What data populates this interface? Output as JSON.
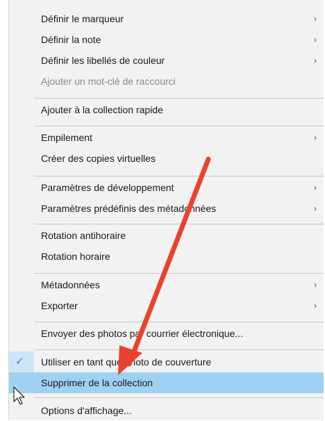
{
  "menu": {
    "items": [
      {
        "label": "Définir le marqueur",
        "submenu_icon": "chevron-right-icon"
      },
      {
        "label": "Définir la note",
        "submenu_icon": "chevron-right-icon"
      },
      {
        "label": "Définir les libellés de couleur",
        "submenu_icon": "chevron-right-icon"
      },
      {
        "label": "Ajouter un mot-clé de raccourci",
        "disabled": true
      },
      {
        "label": "Ajouter à la collection rapide"
      },
      {
        "label": "Empilement",
        "submenu_icon": "chevron-right-icon"
      },
      {
        "label": "Créer des copies virtuelles"
      },
      {
        "label": "Paramètres de développement",
        "submenu_icon": "chevron-right-icon"
      },
      {
        "label": "Paramètres prédéfinis des métadonnées",
        "submenu_icon": "chevron-right-icon"
      },
      {
        "label": "Rotation antihoraire"
      },
      {
        "label": "Rotation horaire"
      },
      {
        "label": "Métadonnées",
        "submenu_icon": "chevron-right-icon"
      },
      {
        "label": "Exporter",
        "submenu_icon": "chevron-right-icon"
      },
      {
        "label": "Envoyer des photos par courrier électronique..."
      },
      {
        "label": "Utiliser en tant que photo de couverture",
        "checked": true
      },
      {
        "label": "Supprimer de la collection",
        "highlighted": true
      },
      {
        "label": "Options d'affichage..."
      }
    ],
    "chevron_glyph": "›",
    "check_glyph": "✓"
  },
  "colors": {
    "menu_background": "#f2f2f2",
    "highlight": "#9fd1f3",
    "check_strip": "#cde6f7",
    "check_mark": "#2b78c2",
    "annotation_arrow": "#e8432f"
  },
  "icons": {
    "cursor": "mouse-pointer-icon",
    "annotation": "red-arrow-icon"
  }
}
